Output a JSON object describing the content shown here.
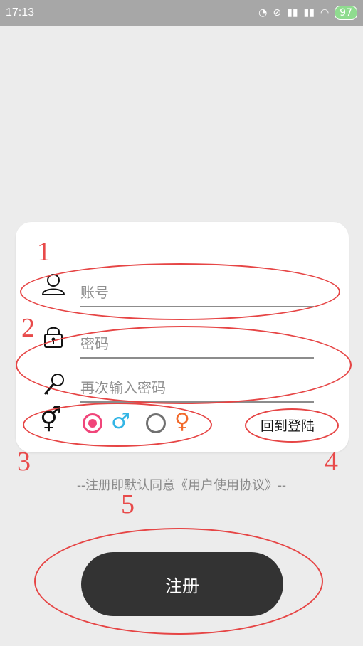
{
  "status_bar": {
    "time": "17:13",
    "battery": "97",
    "icons": [
      "headset-icon",
      "mute-icon",
      "signal-icon",
      "signal-icon",
      "wifi-icon",
      "battery-icon"
    ]
  },
  "form": {
    "account_placeholder": "账号",
    "password_placeholder": "密码",
    "confirm_password_placeholder": "再次输入密码",
    "gender_icons": {
      "gender": "⚥",
      "male": "♂",
      "female": "♀"
    },
    "gender_selected": "male",
    "back_to_login": "回到登陆"
  },
  "agreement": "--注册即默认同意《用户使用协议》--",
  "register_button": "注册",
  "annotations": [
    "1",
    "2",
    "3",
    "4",
    "5"
  ],
  "colors": {
    "accent": "#f0457a",
    "male": "#33b5e5",
    "female": "#f26a2c",
    "button": "#333333",
    "annotation": "#e64545"
  }
}
